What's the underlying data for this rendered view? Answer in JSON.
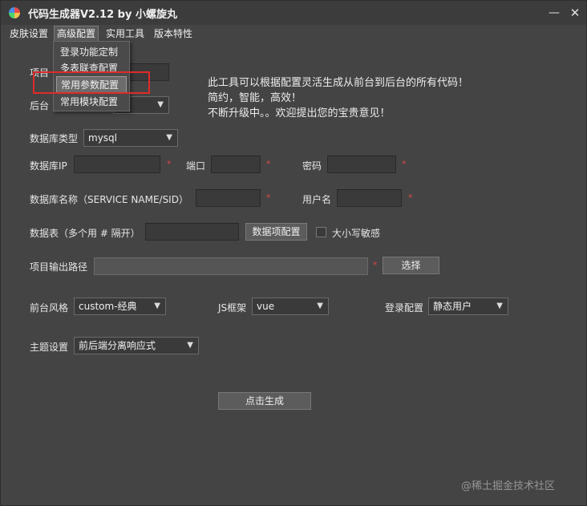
{
  "window": {
    "title": "代码生成器V2.12 by 小螺旋丸",
    "min_symbol": "—",
    "close_symbol": "✕"
  },
  "menu": {
    "skin": "皮肤设置",
    "advanced": "高级配置",
    "tools": "实用工具",
    "version": "版本特性"
  },
  "dropdown": {
    "items": [
      "登录功能定制",
      "多表联查配置",
      "常用参数配置",
      "常用模块配置"
    ]
  },
  "info": {
    "line1": "此工具可以根据配置灵活生成从前台到后台的所有代码！",
    "line2": "简约，智能，高效！",
    "line3": "不断升级中。。欢迎提出您的宝贵意见！"
  },
  "form": {
    "project_label_partial": "项目",
    "backend_label_partial": "后台",
    "db_type_label": "数据库类型",
    "db_type_value": "mysql",
    "db_ip_label": "数据库IP",
    "port_label": "端口",
    "password_label": "密码",
    "db_name_label": "数据库名称（SERVICE NAME/SID）",
    "username_label": "用户名",
    "tables_label": "数据表（多个用 # 隔开）",
    "table_config_button": "数据项配置",
    "case_sensitive_label": "大小写敏感",
    "output_path_label": "项目输出路径",
    "choose_button": "选择",
    "frontend_style_label": "前台风格",
    "frontend_style_value": "custom-经典",
    "js_framework_label": "JS框架",
    "js_framework_value": "vue",
    "login_config_label": "登录配置",
    "login_config_value": "静态用户",
    "theme_label": "主题设置",
    "theme_value": "前后端分离响应式",
    "generate_button": "点击生成",
    "required_mark": "*"
  },
  "watermark": "@稀土掘金技术社区"
}
